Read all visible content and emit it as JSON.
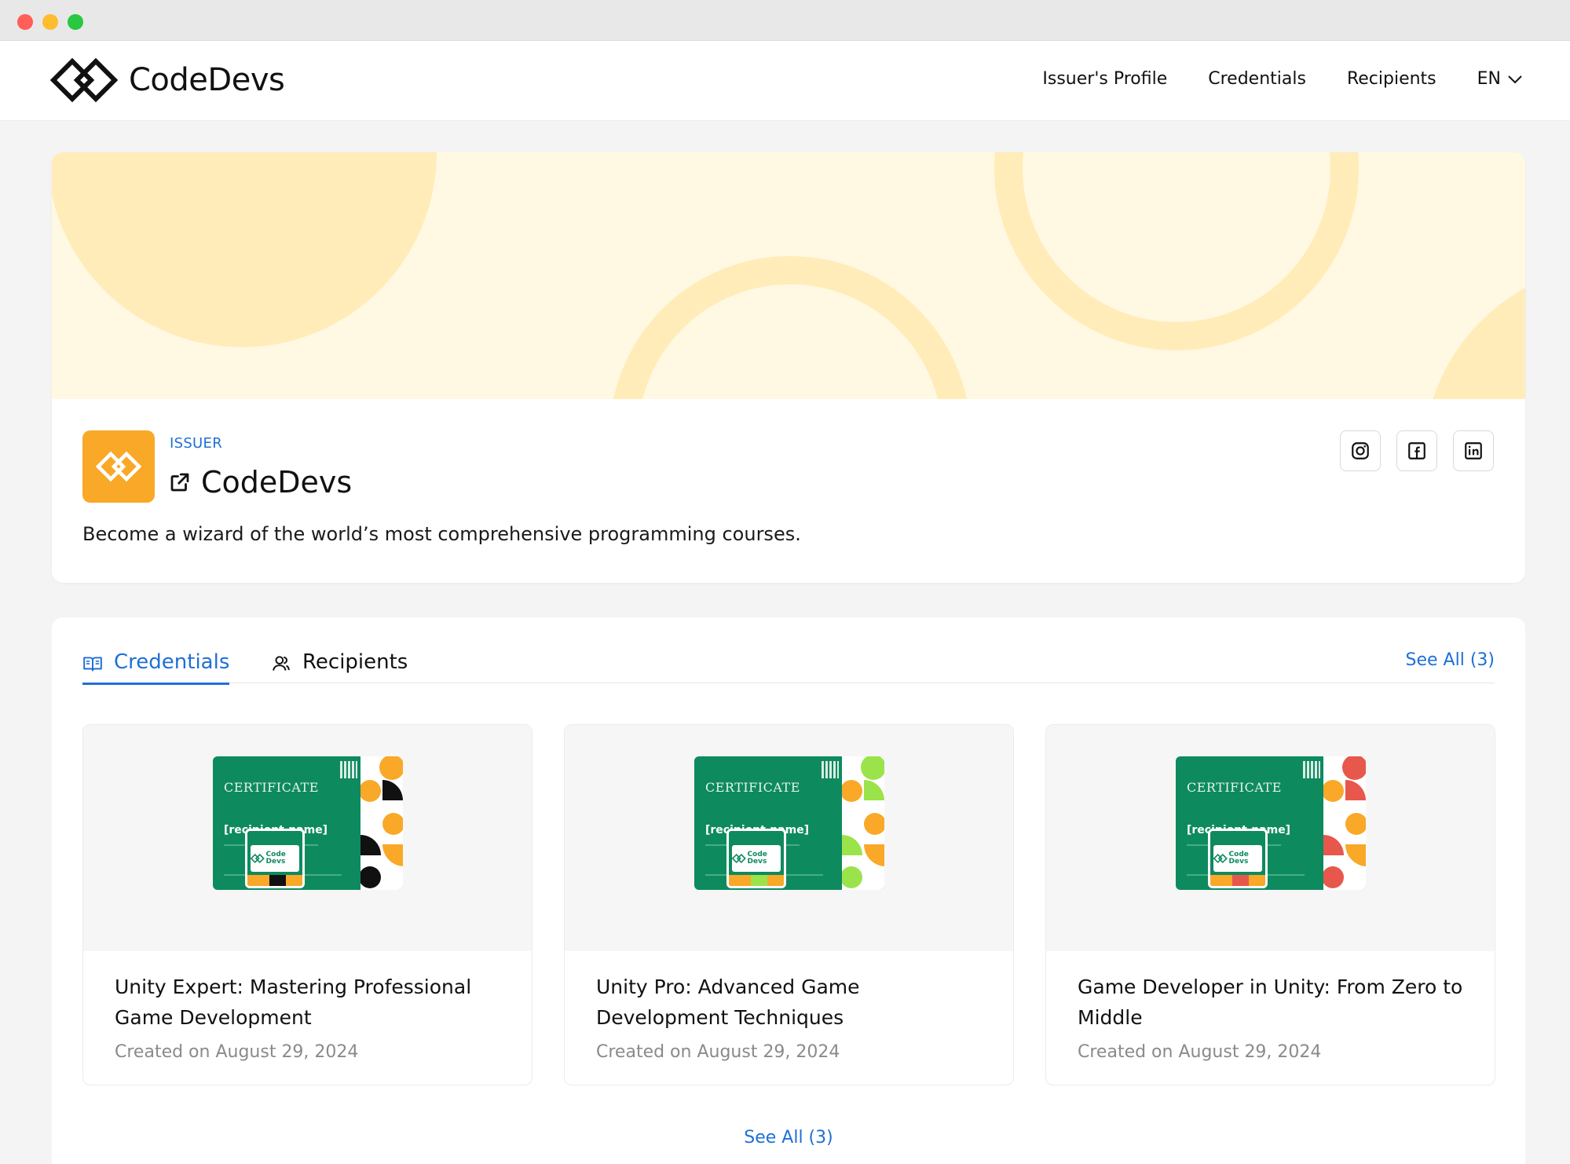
{
  "header": {
    "brand": "CodeDevs",
    "nav": [
      "Issuer's Profile",
      "Credentials",
      "Recipients"
    ],
    "language": "EN"
  },
  "profile": {
    "label": "ISSUER",
    "name": "CodeDevs",
    "description": "Become a wizard of the world’s most comprehensive programming courses.",
    "socials": [
      "instagram-icon",
      "facebook-icon",
      "linkedin-icon"
    ]
  },
  "credentials_section": {
    "tabs": [
      {
        "label": "Credentials",
        "icon": "book-open-icon",
        "active": true
      },
      {
        "label": "Recipients",
        "icon": "users-icon",
        "active": false
      }
    ],
    "see_all_top": "See All (3)",
    "see_all_bottom": "See All (3)",
    "items": [
      {
        "title": "Unity Expert: Mastering Professional Game Development",
        "date": "Created on August 29, 2024",
        "certificate": {
          "heading": "CERTIFICATE",
          "recipient": "[recipient.name]",
          "badge": "Code Devs",
          "accent": "#f9a828",
          "accent2": "#111111"
        }
      },
      {
        "title": "Unity Pro: Advanced Game Development Techniques",
        "date": "Created on August 29, 2024",
        "certificate": {
          "heading": "CERTIFICATE",
          "recipient": "[recipient.name]",
          "badge": "Code Devs",
          "accent": "#f9a828",
          "accent2": "#9be34a"
        }
      },
      {
        "title": "Game Developer in Unity: From Zero to Middle",
        "date": "Created on August 29, 2024",
        "certificate": {
          "heading": "CERTIFICATE",
          "recipient": "[recipient.name]",
          "badge": "Code Devs",
          "accent": "#f9a828",
          "accent2": "#e8574b"
        }
      }
    ]
  },
  "colors": {
    "accent_blue": "#1f6fd6",
    "brand_orange": "#f9a828",
    "certificate_green": "#0e8a5f",
    "banner_bg": "#fff8e3"
  }
}
